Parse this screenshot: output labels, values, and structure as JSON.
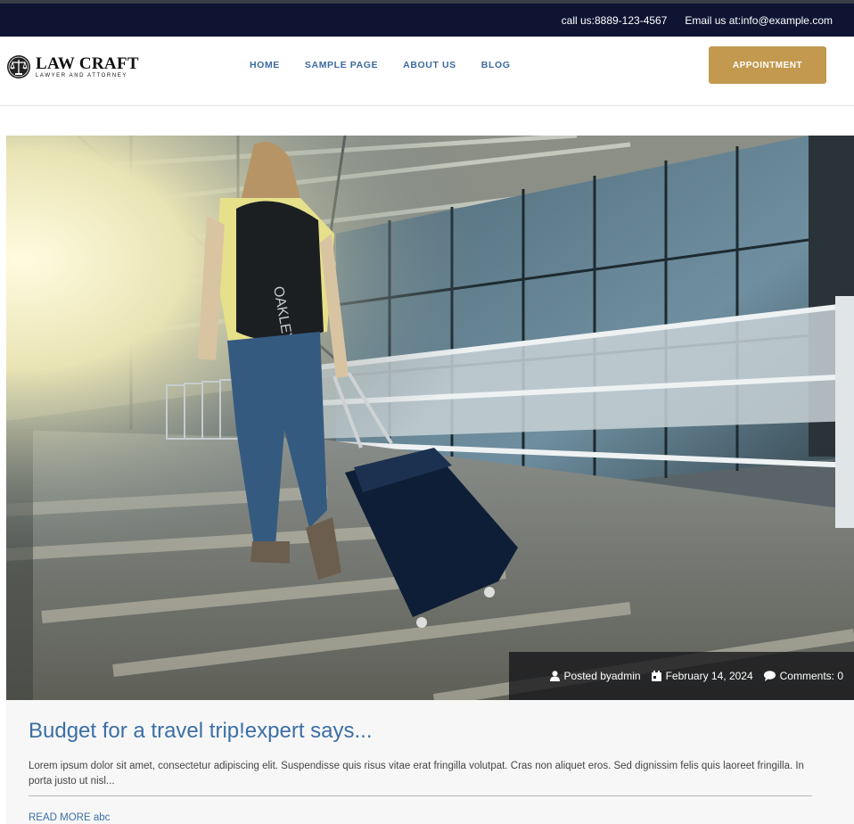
{
  "topbar": {
    "phone": "call us:8889-123-4567",
    "email": "Email us at:info@example.com"
  },
  "logo": {
    "title": "LAW CRAFT",
    "subtitle": "LAWYER AND ATTORNEY",
    "icon": "scales-of-justice-icon"
  },
  "nav": {
    "items": [
      "HOME",
      "SAMPLE PAGE",
      "ABOUT US",
      "BLOG"
    ]
  },
  "appointment_label": "APPOINTMENT",
  "colors": {
    "topbar_bg": "#0f1432",
    "accent": "#c2994f",
    "link": "#3b6fa6"
  },
  "post": {
    "image_alt": "Woman with backpack pulling a suitcase in an airport terminal",
    "meta": {
      "author_label": "Posted byadmin",
      "date": "February 14, 2024",
      "comments": "Comments: 0"
    },
    "title": "Budget for a travel trip!expert says...",
    "excerpt": "Lorem ipsum dolor sit amet, consectetur adipiscing elit. Suspendisse quis risus vitae erat fringilla volutpat. Cras non aliquet eros. Sed dignissim felis quis laoreet fringilla. In porta justo ut nisl...",
    "read_more": "READ MORE abc"
  }
}
